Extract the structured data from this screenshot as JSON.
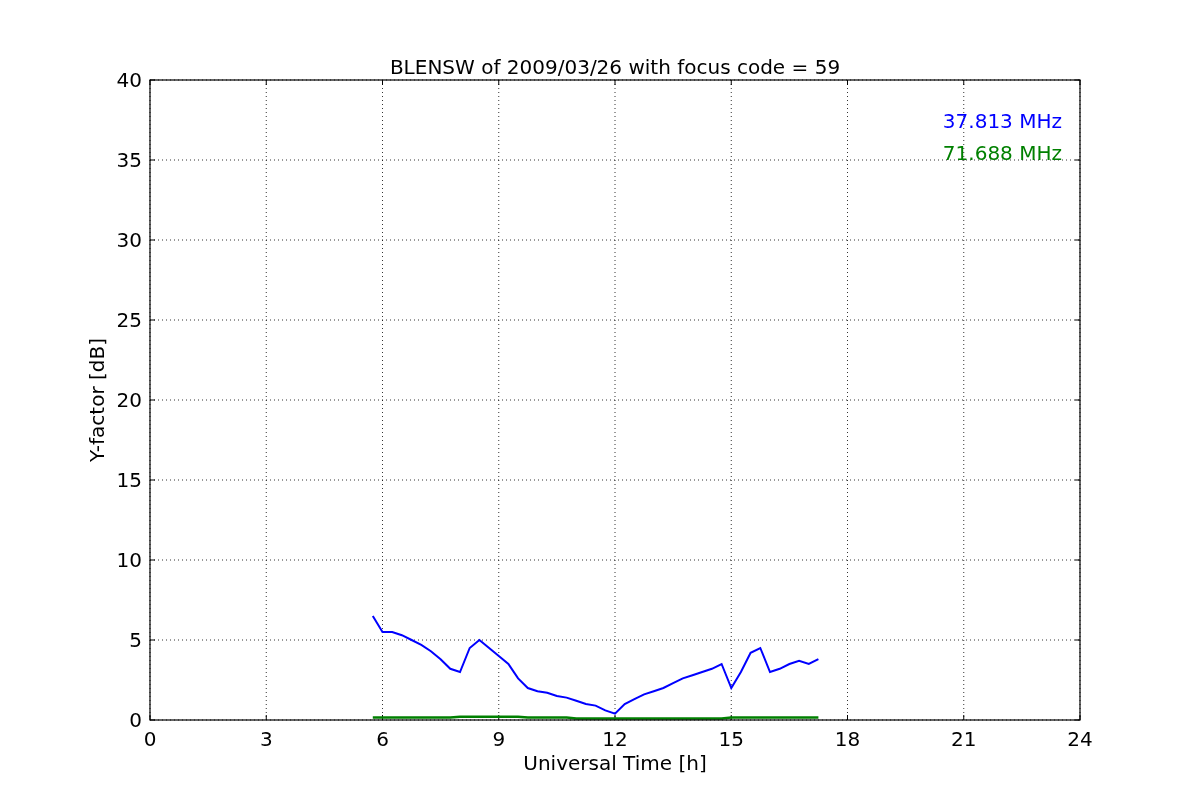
{
  "chart_data": {
    "type": "line",
    "title": "BLENSW of 2009/03/26 with focus code = 59",
    "xlabel": "Universal Time [h]",
    "ylabel": "Y-factor [dB]",
    "x": [
      5.75,
      6,
      6.25,
      6.5,
      6.75,
      7,
      7.25,
      7.5,
      7.75,
      8,
      8.25,
      8.5,
      8.75,
      9,
      9.25,
      9.5,
      9.75,
      10,
      10.25,
      10.5,
      10.75,
      11,
      11.25,
      11.5,
      11.75,
      12,
      12.25,
      12.5,
      12.75,
      13,
      13.25,
      13.5,
      13.75,
      14,
      14.25,
      14.5,
      14.75,
      15,
      15.25,
      15.5,
      15.75,
      16,
      16.25,
      16.5,
      16.75,
      17,
      17.25
    ],
    "series": [
      {
        "name": "37.813 MHz",
        "color": "#0000ff",
        "values": [
          6.5,
          5.5,
          5.5,
          5.3,
          5.0,
          4.7,
          4.3,
          3.8,
          3.2,
          3.0,
          4.5,
          5.0,
          4.5,
          4.0,
          3.5,
          2.6,
          2.0,
          1.8,
          1.7,
          1.5,
          1.4,
          1.2,
          1.0,
          0.9,
          0.6,
          0.4,
          1.0,
          1.3,
          1.6,
          1.8,
          2.0,
          2.3,
          2.6,
          2.8,
          3.0,
          3.2,
          3.5,
          2.0,
          3.0,
          4.2,
          4.5,
          3.0,
          3.2,
          3.5,
          3.7,
          3.5,
          3.8
        ]
      },
      {
        "name": "71.688 MHz",
        "color": "#008000",
        "values": [
          0.15,
          0.15,
          0.15,
          0.15,
          0.15,
          0.15,
          0.15,
          0.15,
          0.15,
          0.2,
          0.2,
          0.2,
          0.2,
          0.2,
          0.2,
          0.2,
          0.15,
          0.15,
          0.15,
          0.15,
          0.15,
          0.1,
          0.1,
          0.1,
          0.1,
          0.1,
          0.1,
          0.1,
          0.1,
          0.1,
          0.1,
          0.1,
          0.1,
          0.1,
          0.1,
          0.1,
          0.1,
          0.15,
          0.15,
          0.15,
          0.15,
          0.15,
          0.15,
          0.15,
          0.15,
          0.15,
          0.15
        ]
      }
    ],
    "xlim": [
      0,
      24
    ],
    "ylim": [
      0,
      40
    ],
    "xticks": [
      0,
      3,
      6,
      9,
      12,
      15,
      18,
      21,
      24
    ],
    "yticks": [
      0,
      5,
      10,
      15,
      20,
      25,
      30,
      35,
      40
    ],
    "grid": true
  }
}
